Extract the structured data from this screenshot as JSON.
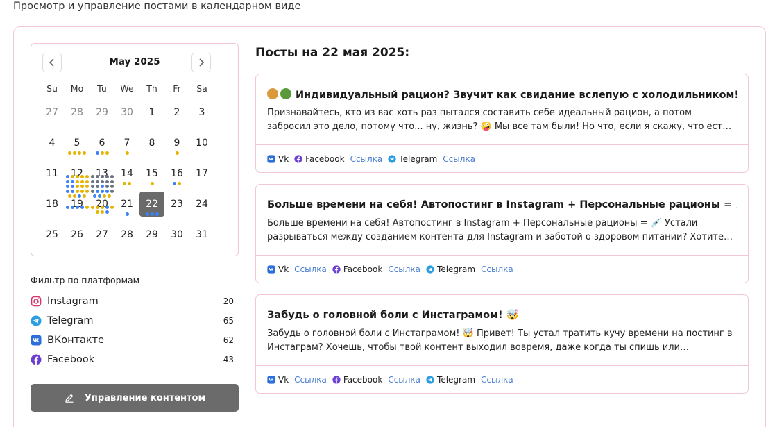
{
  "page": {
    "subtitle": "Просмотр и управление постами в календарном виде"
  },
  "colors": {
    "accent_pink_border": "#f3c7d3",
    "selected_day": "#6a6a6a",
    "dot_blue": "#3b82f6",
    "dot_yellow": "#e6b400",
    "dot_gray": "#6b7280",
    "link": "#4a7fd0",
    "button": "#6b6b6b"
  },
  "calendar": {
    "month_title": "May 2025",
    "prev_icon": "chevron-left-icon",
    "next_icon": "chevron-right-icon",
    "weekdays": [
      "Su",
      "Mo",
      "Tu",
      "We",
      "Th",
      "Fr",
      "Sa"
    ],
    "weeks": [
      [
        {
          "d": "27",
          "muted": true
        },
        {
          "d": "28",
          "muted": true
        },
        {
          "d": "29",
          "muted": true
        },
        {
          "d": "30",
          "muted": true
        },
        {
          "d": "1"
        },
        {
          "d": "2"
        },
        {
          "d": "3"
        }
      ],
      [
        {
          "d": "4"
        },
        {
          "d": "5",
          "dots": [
            "y",
            "y",
            "y",
            "y"
          ]
        },
        {
          "d": "6",
          "dots": [
            "b",
            "y",
            "y"
          ]
        },
        {
          "d": "7",
          "dots": [
            "y"
          ]
        },
        {
          "d": "8"
        },
        {
          "d": "9",
          "dots": [
            "y"
          ]
        },
        {
          "d": "10"
        }
      ],
      [
        {
          "d": "11"
        },
        {
          "d": "12",
          "dots": [
            "b",
            "y",
            "y",
            "y",
            "y",
            "b",
            "b",
            "y",
            "y",
            "y",
            "b",
            "b",
            "y",
            "y",
            "y",
            "b",
            "b",
            "y",
            "y",
            "y",
            "y",
            "y",
            "b",
            "y"
          ]
        },
        {
          "d": "13",
          "dots": [
            "g",
            "g",
            "g",
            "g",
            "g",
            "g",
            "g",
            "g",
            "g",
            "g",
            "g",
            "g",
            "b",
            "g",
            "g",
            "g",
            "b",
            "b",
            "b",
            "g",
            "b",
            "b",
            "y",
            "y"
          ]
        },
        {
          "d": "14",
          "dots": [
            "y",
            "y"
          ]
        },
        {
          "d": "15",
          "dots": [
            "y"
          ]
        },
        {
          "d": "16",
          "dots": [
            "b",
            "y"
          ]
        },
        {
          "d": "17"
        }
      ],
      [
        {
          "d": "18"
        },
        {
          "d": "19",
          "dots": [
            "b",
            "b",
            "b",
            "b",
            "y"
          ]
        },
        {
          "d": "20",
          "dots": [
            "y",
            "y",
            "y",
            "b",
            "y",
            "y",
            "y",
            "b"
          ]
        },
        {
          "d": "21",
          "dots": [
            "b"
          ]
        },
        {
          "d": "22",
          "selected": true,
          "dots": [
            "b",
            "b",
            "b"
          ]
        },
        {
          "d": "23"
        },
        {
          "d": "24"
        }
      ],
      [
        {
          "d": "25"
        },
        {
          "d": "26"
        },
        {
          "d": "27"
        },
        {
          "d": "28"
        },
        {
          "d": "29"
        },
        {
          "d": "30"
        },
        {
          "d": "31"
        }
      ]
    ]
  },
  "filter": {
    "title": "Фильтр по платформам",
    "platforms": [
      {
        "name": "Instagram",
        "count": "20",
        "icon": "instagram-icon"
      },
      {
        "name": "Telegram",
        "count": "65",
        "icon": "telegram-icon"
      },
      {
        "name": "ВКонтакте",
        "count": "62",
        "icon": "vk-icon"
      },
      {
        "name": "Facebook",
        "count": "43",
        "icon": "facebook-icon"
      }
    ]
  },
  "manage_button": {
    "label": "Управление контентом",
    "icon": "pencil-icon"
  },
  "posts": {
    "title": "Посты на 22 мая 2025:",
    "items": [
      {
        "title": "Индивидуальный рацион? Звучит как свидание вслепую с холодильником!",
        "body": "Признавайтесь, кто из вас хоть раз пытался составить себе идеальный рацион, а потом забросил это дело, потому что... ну, жизнь? 🤪 Мы все там были! Но что, если я скажу, что есть способ сделать это проще?",
        "footer": [
          {
            "type": "platform",
            "label": "Vk",
            "icon": "vk-icon"
          },
          {
            "type": "platform",
            "label": "Facebook",
            "icon": "facebook-icon"
          },
          {
            "type": "link",
            "label": "Ссылка"
          },
          {
            "type": "platform",
            "label": "Telegram",
            "icon": "telegram-icon"
          },
          {
            "type": "link",
            "label": "Ссылка"
          }
        ]
      },
      {
        "title": "Больше времени на себя! Автопостинг в Instagram + Персональные рационы = 💉",
        "body": "Больше времени на себя! Автопостинг в Instagram + Персональные рационы = 💉 Устали разрываться между созданием контента для Instagram и заботой о здоровом питании? Хотите больше времени на себя?",
        "footer": [
          {
            "type": "platform",
            "label": "Vk",
            "icon": "vk-icon"
          },
          {
            "type": "link",
            "label": "Ссылка"
          },
          {
            "type": "platform",
            "label": "Facebook",
            "icon": "facebook-icon"
          },
          {
            "type": "link",
            "label": "Ссылка"
          },
          {
            "type": "platform",
            "label": "Telegram",
            "icon": "telegram-icon"
          },
          {
            "type": "link",
            "label": "Ссылка"
          }
        ]
      },
      {
        "title": "Забудь о головной боли с Инстаграмом! 🤯",
        "body": "Забудь о головной боли с Инстаграмом! 🤯 Привет! Ты устал тратить кучу времени на постинг в Инстаграм? Хочешь, чтобы твой контент выходил вовремя, даже когда ты спишь или отдыхаешь? Тогда читай дальше!",
        "footer": [
          {
            "type": "platform",
            "label": "Vk",
            "icon": "vk-icon"
          },
          {
            "type": "link",
            "label": "Ссылка"
          },
          {
            "type": "platform",
            "label": "Facebook",
            "icon": "facebook-icon"
          },
          {
            "type": "link",
            "label": "Ссылка"
          },
          {
            "type": "platform",
            "label": "Telegram",
            "icon": "telegram-icon"
          },
          {
            "type": "link",
            "label": "Ссылка"
          }
        ]
      }
    ]
  }
}
